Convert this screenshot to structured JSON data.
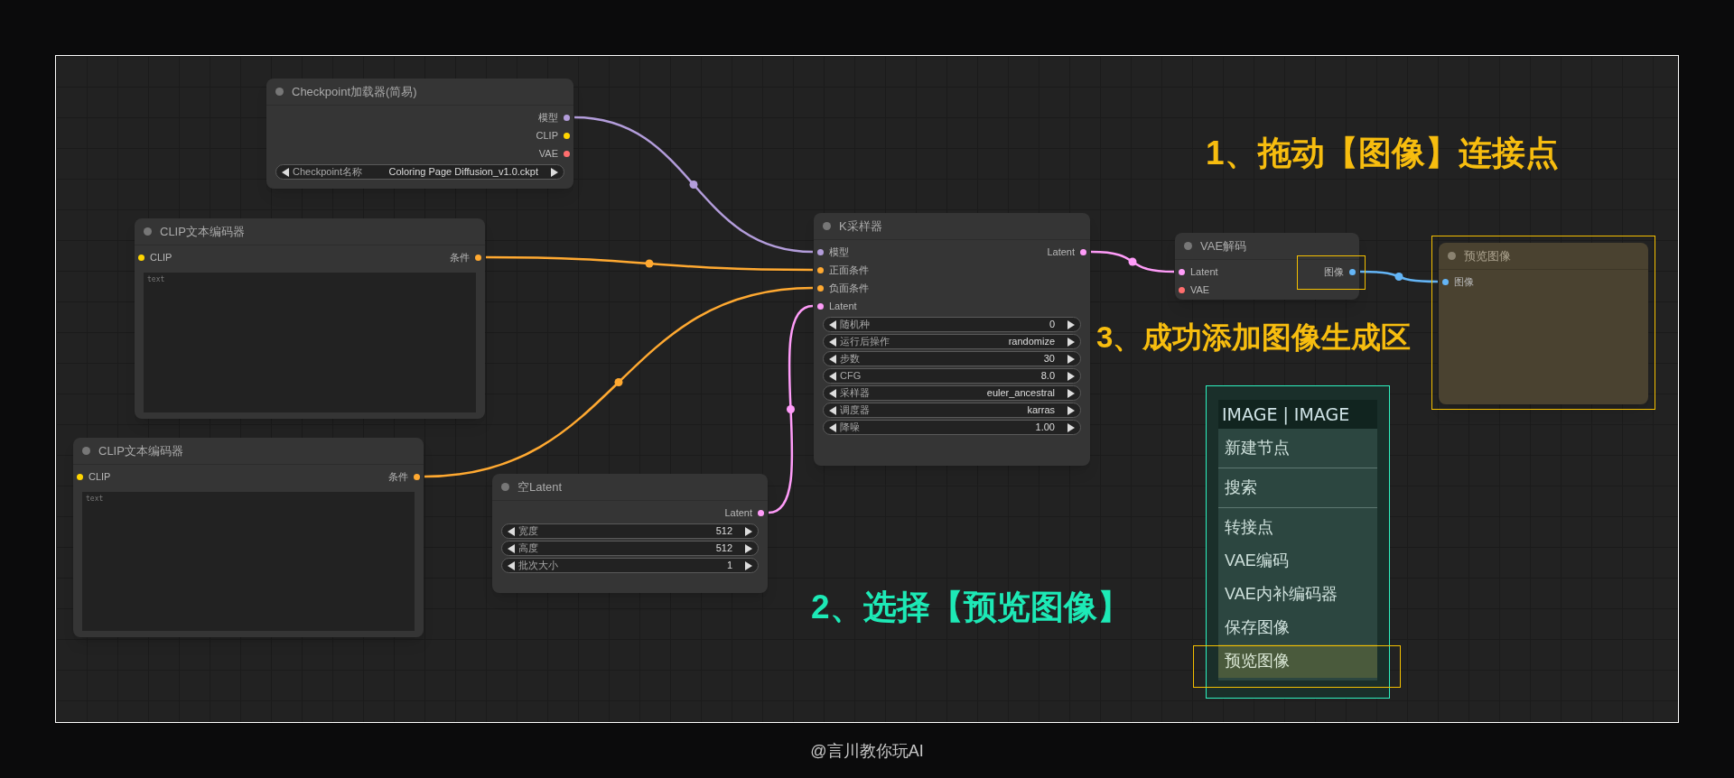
{
  "nodes": [
    {
      "title": "Checkpoint加载器(简易)",
      "selected": false,
      "outputs": [
        {
          "label": "模型",
          "color": "#b39ddb"
        },
        {
          "label": "CLIP",
          "color": "#ffd500"
        },
        {
          "label": "VAE",
          "color": "#ff6e6e"
        }
      ],
      "widgets": [
        {
          "label": "Checkpoint名称",
          "value": "Coloring Page Diffusion_v1.0.ckpt"
        }
      ]
    },
    {
      "title": "CLIP文本编码器",
      "selected": false,
      "inputs": [
        {
          "label": "CLIP",
          "color": "#ffd500"
        }
      ],
      "outputs": [
        {
          "label": "条件",
          "color": "#ffa931"
        }
      ],
      "textarea": {
        "placeholder": "text"
      }
    },
    {
      "title": "CLIP文本编码器",
      "selected": false,
      "inputs": [
        {
          "label": "CLIP",
          "color": "#ffd500"
        }
      ],
      "outputs": [
        {
          "label": "条件",
          "color": "#ffa931"
        }
      ],
      "textarea": {
        "placeholder": "text"
      }
    },
    {
      "title": "空Latent",
      "selected": false,
      "outputs": [
        {
          "label": "Latent",
          "color": "#ff9cf9"
        }
      ],
      "widgets": [
        {
          "label": "宽度",
          "value": "512"
        },
        {
          "label": "高度",
          "value": "512"
        },
        {
          "label": "批次大小",
          "value": "1"
        }
      ]
    },
    {
      "title": "K采样器",
      "selected": false,
      "inputs": [
        {
          "label": "模型",
          "color": "#b39ddb"
        },
        {
          "label": "正面条件",
          "color": "#ffa931"
        },
        {
          "label": "负面条件",
          "color": "#ffa931"
        },
        {
          "label": "Latent",
          "color": "#ff9cf9"
        }
      ],
      "outputs": [
        {
          "label": "Latent",
          "color": "#ff9cf9"
        }
      ],
      "widgets": [
        {
          "label": "随机种",
          "value": "0"
        },
        {
          "label": "运行后操作",
          "value": "randomize"
        },
        {
          "label": "步数",
          "value": "30"
        },
        {
          "label": "CFG",
          "value": "8.0"
        },
        {
          "label": "采样器",
          "value": "euler_ancestral"
        },
        {
          "label": "调度器",
          "value": "karras"
        },
        {
          "label": "降噪",
          "value": "1.00"
        }
      ]
    },
    {
      "title": "VAE解码",
      "selected": false,
      "inputs": [
        {
          "label": "Latent",
          "color": "#ff9cf9"
        },
        {
          "label": "VAE",
          "color": "#ff6e6e"
        }
      ],
      "outputs": [
        {
          "label": "图像",
          "color": "#64b5f6"
        }
      ]
    },
    {
      "title": "预览图像",
      "selected": true,
      "inputs": [
        {
          "label": "图像",
          "color": "#64b5f6"
        }
      ]
    }
  ],
  "context_menu": {
    "title": "IMAGE | IMAGE",
    "groups": [
      [
        {
          "label": "新建节点",
          "selected": false
        }
      ],
      [
        {
          "label": "搜索",
          "selected": false
        }
      ],
      [
        {
          "label": "转接点",
          "selected": false
        },
        {
          "label": "VAE编码",
          "selected": false
        },
        {
          "label": "VAE内补编码器",
          "selected": false
        },
        {
          "label": "保存图像",
          "selected": false
        },
        {
          "label": "预览图像",
          "selected": true
        }
      ]
    ]
  },
  "annotations": [
    {
      "text": "1、拖动【图像】连接点",
      "color": "#f7bd0f"
    },
    {
      "text": "3、成功添加图像生成区",
      "color": "#f7bd0f"
    },
    {
      "text": "2、选择【预览图像】",
      "color": "#1de9b6"
    }
  ],
  "credit": "@言川教你玩AI"
}
